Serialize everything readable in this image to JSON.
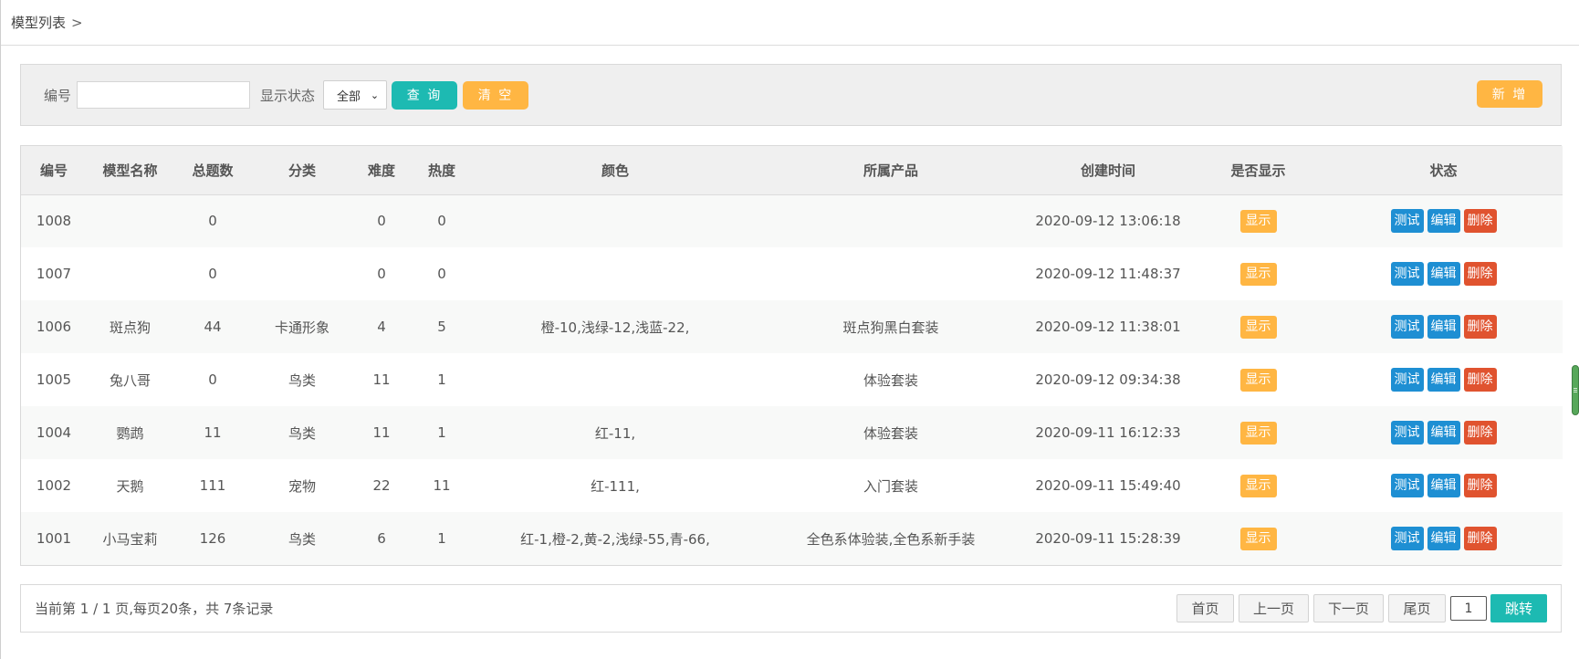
{
  "breadcrumb": {
    "label": "模型列表",
    "separator": ">"
  },
  "filter": {
    "number_label": "编号",
    "number_value": "",
    "status_label": "显示状态",
    "status_selected": "全部",
    "query_label": "查 询",
    "clear_label": "清 空",
    "add_label": "新 增"
  },
  "table": {
    "columns": [
      "编号",
      "模型名称",
      "总题数",
      "分类",
      "难度",
      "热度",
      "颜色",
      "所属产品",
      "创建时间",
      "是否显示",
      "状态"
    ],
    "rows": [
      {
        "id": "1008",
        "name": "",
        "total": "0",
        "category": "",
        "difficulty": "0",
        "heat": "0",
        "colors": "",
        "product": "",
        "created": "2020-09-12 13:06:18",
        "show": "显示"
      },
      {
        "id": "1007",
        "name": "",
        "total": "0",
        "category": "",
        "difficulty": "0",
        "heat": "0",
        "colors": "",
        "product": "",
        "created": "2020-09-12 11:48:37",
        "show": "显示"
      },
      {
        "id": "1006",
        "name": "斑点狗",
        "total": "44",
        "category": "卡通形象",
        "difficulty": "4",
        "heat": "5",
        "colors": "橙-10,浅绿-12,浅蓝-22,",
        "product": "斑点狗黑白套装",
        "created": "2020-09-12 11:38:01",
        "show": "显示"
      },
      {
        "id": "1005",
        "name": "兔八哥",
        "total": "0",
        "category": "鸟类",
        "difficulty": "11",
        "heat": "1",
        "colors": "",
        "product": "体验套装",
        "created": "2020-09-12 09:34:38",
        "show": "显示"
      },
      {
        "id": "1004",
        "name": "鹦鹉",
        "total": "11",
        "category": "鸟类",
        "difficulty": "11",
        "heat": "1",
        "colors": "红-11,",
        "product": "体验套装",
        "created": "2020-09-11 16:12:33",
        "show": "显示"
      },
      {
        "id": "1002",
        "name": "天鹅",
        "total": "111",
        "category": "宠物",
        "difficulty": "22",
        "heat": "11",
        "colors": "红-111,",
        "product": "入门套装",
        "created": "2020-09-11 15:49:40",
        "show": "显示"
      },
      {
        "id": "1001",
        "name": "小马宝莉",
        "total": "126",
        "category": "鸟类",
        "difficulty": "6",
        "heat": "1",
        "colors": "红-1,橙-2,黄-2,浅绿-55,青-66,",
        "product": "全色系体验装,全色系新手装",
        "created": "2020-09-11 15:28:39",
        "show": "显示"
      }
    ],
    "actions": {
      "test": "测试",
      "edit": "编辑",
      "delete": "删除"
    }
  },
  "footer": {
    "info": "当前第 1 / 1 页,每页20条，共 7条记录",
    "first": "首页",
    "prev": "上一页",
    "next": "下一页",
    "last": "尾页",
    "page_value": "1",
    "jump": "跳转"
  },
  "colors": {
    "teal": "#1dbab2",
    "orange": "#ffb643",
    "blue": "#1e8fd3",
    "red": "#e0532f"
  }
}
